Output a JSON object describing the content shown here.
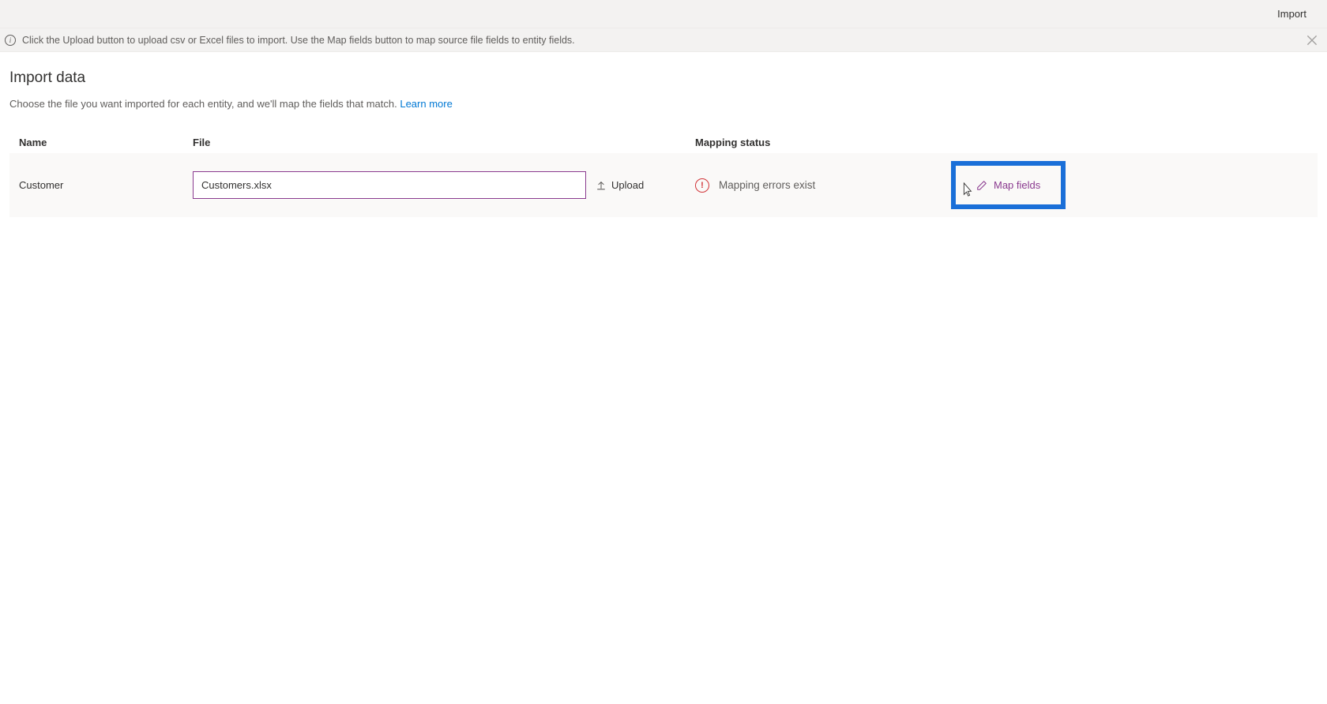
{
  "command_bar": {
    "import_label": "Import"
  },
  "info_bar": {
    "message": "Click the Upload button to upload csv or Excel files to import. Use the Map fields button to map source file fields to entity fields."
  },
  "page": {
    "title": "Import data",
    "description": "Choose the file you want imported for each entity, and we'll map the fields that match. ",
    "learn_more": "Learn more"
  },
  "columns": {
    "name": "Name",
    "file": "File",
    "status": "Mapping status"
  },
  "rows": [
    {
      "entity": "Customer",
      "file_value": "Customers.xlsx",
      "upload_label": "Upload",
      "status_text": "Mapping errors exist",
      "map_fields_label": "Map fields"
    }
  ]
}
